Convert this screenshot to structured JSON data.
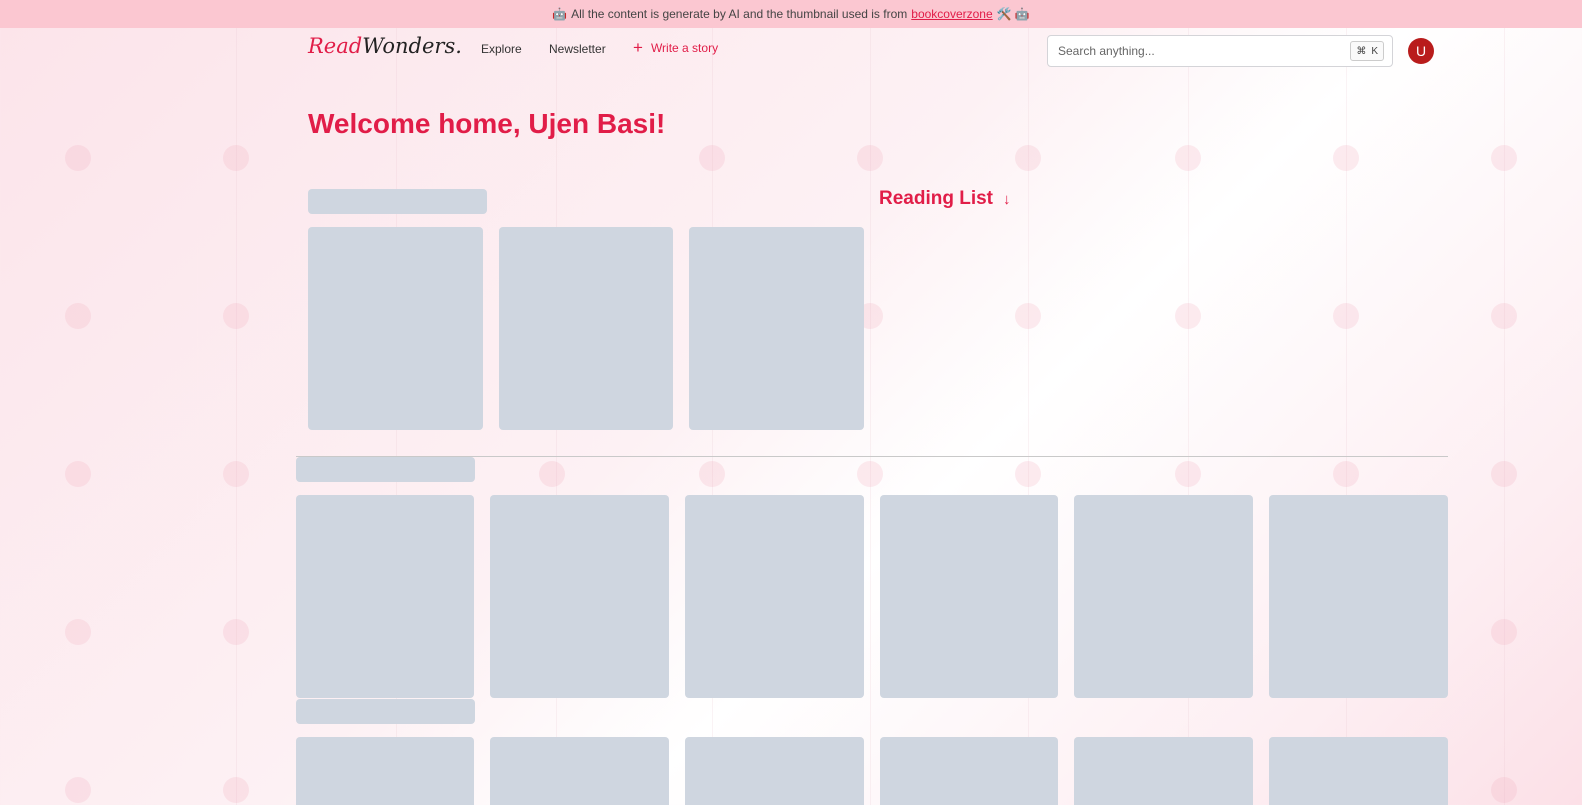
{
  "banner": {
    "emoji_left": "🤖",
    "text": "All the content is generate by AI and the thumbnail used is from",
    "link": "bookcoverzone",
    "emoji_right": "🛠️ 🤖"
  },
  "header": {
    "logo_part1": "Read",
    "logo_part2": "Wonders.",
    "nav": {
      "explore": "Explore",
      "newsletter": "Newsletter",
      "write_plus": "+",
      "write": "Write a story"
    },
    "search": {
      "placeholder": "Search anything...",
      "shortcut_icon": "⌘",
      "shortcut_key": "K"
    },
    "avatar_initial": "U"
  },
  "main": {
    "welcome": "Welcome home, Ujen Basi!",
    "reading_list": "Reading List",
    "reading_list_arrow": "↓"
  },
  "colors": {
    "accent": "#e11d48",
    "skeleton": "#cfd6e0",
    "banner_bg": "#fbc7d1",
    "avatar_bg": "#b91c1c"
  }
}
